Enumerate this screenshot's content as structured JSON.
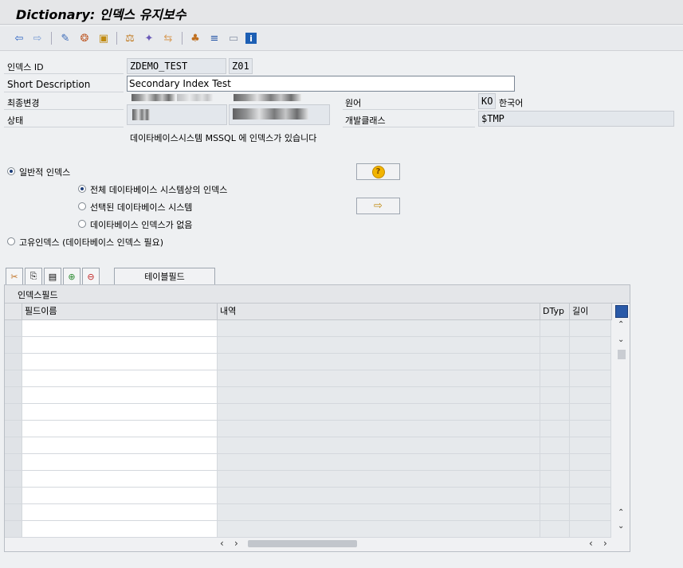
{
  "window": {
    "title": "Dictionary: 인덱스 유지보수"
  },
  "toolbar": {
    "icons": [
      "back-icon",
      "forward-icon",
      "display-change-icon",
      "active-inactive-icon",
      "object-list-icon",
      "other-object-icon",
      "check-icon",
      "activate-icon",
      "where-used-icon",
      "hierarchy-icon",
      "navigator-icon",
      "display-object-list-icon",
      "info-icon"
    ]
  },
  "fields": {
    "index_id_label": "인덱스 ID",
    "index_table": "ZDEMO_TEST",
    "index_name": "Z01",
    "short_desc_label": "Short Description",
    "short_desc_value": "Secondary Index Test",
    "last_changed_label": "최종변경",
    "status_label": "상태",
    "lang_label": "원어",
    "lang_code": "KO",
    "lang_name": "한국어",
    "devclass_label": "개발클래스",
    "devclass_value": "$TMP",
    "db_msg": "데이타베이스시스템 MSSQL 에 인덱스가 있습니다"
  },
  "options": {
    "normal_index": "일반적 인덱스",
    "all_db": "전체 데이타베이스 시스템상의 인덱스",
    "selected_db": "선택된 데이타베이스 시스템",
    "no_db": "데이타베이스 인덱스가 없음",
    "unique_index": "고유인덱스 (데이타베이스 인덱스 필요)"
  },
  "table": {
    "tab_label": "테이블필드",
    "section_title": "인덱스필드",
    "columns": [
      "필드이름",
      "내역",
      "DTyp",
      "길이"
    ],
    "row_count": 13
  },
  "colors": {
    "accent": "#1d3f7a",
    "readonly_bg": "#e3e7ec",
    "grid_bg": "#e6e9ec"
  }
}
